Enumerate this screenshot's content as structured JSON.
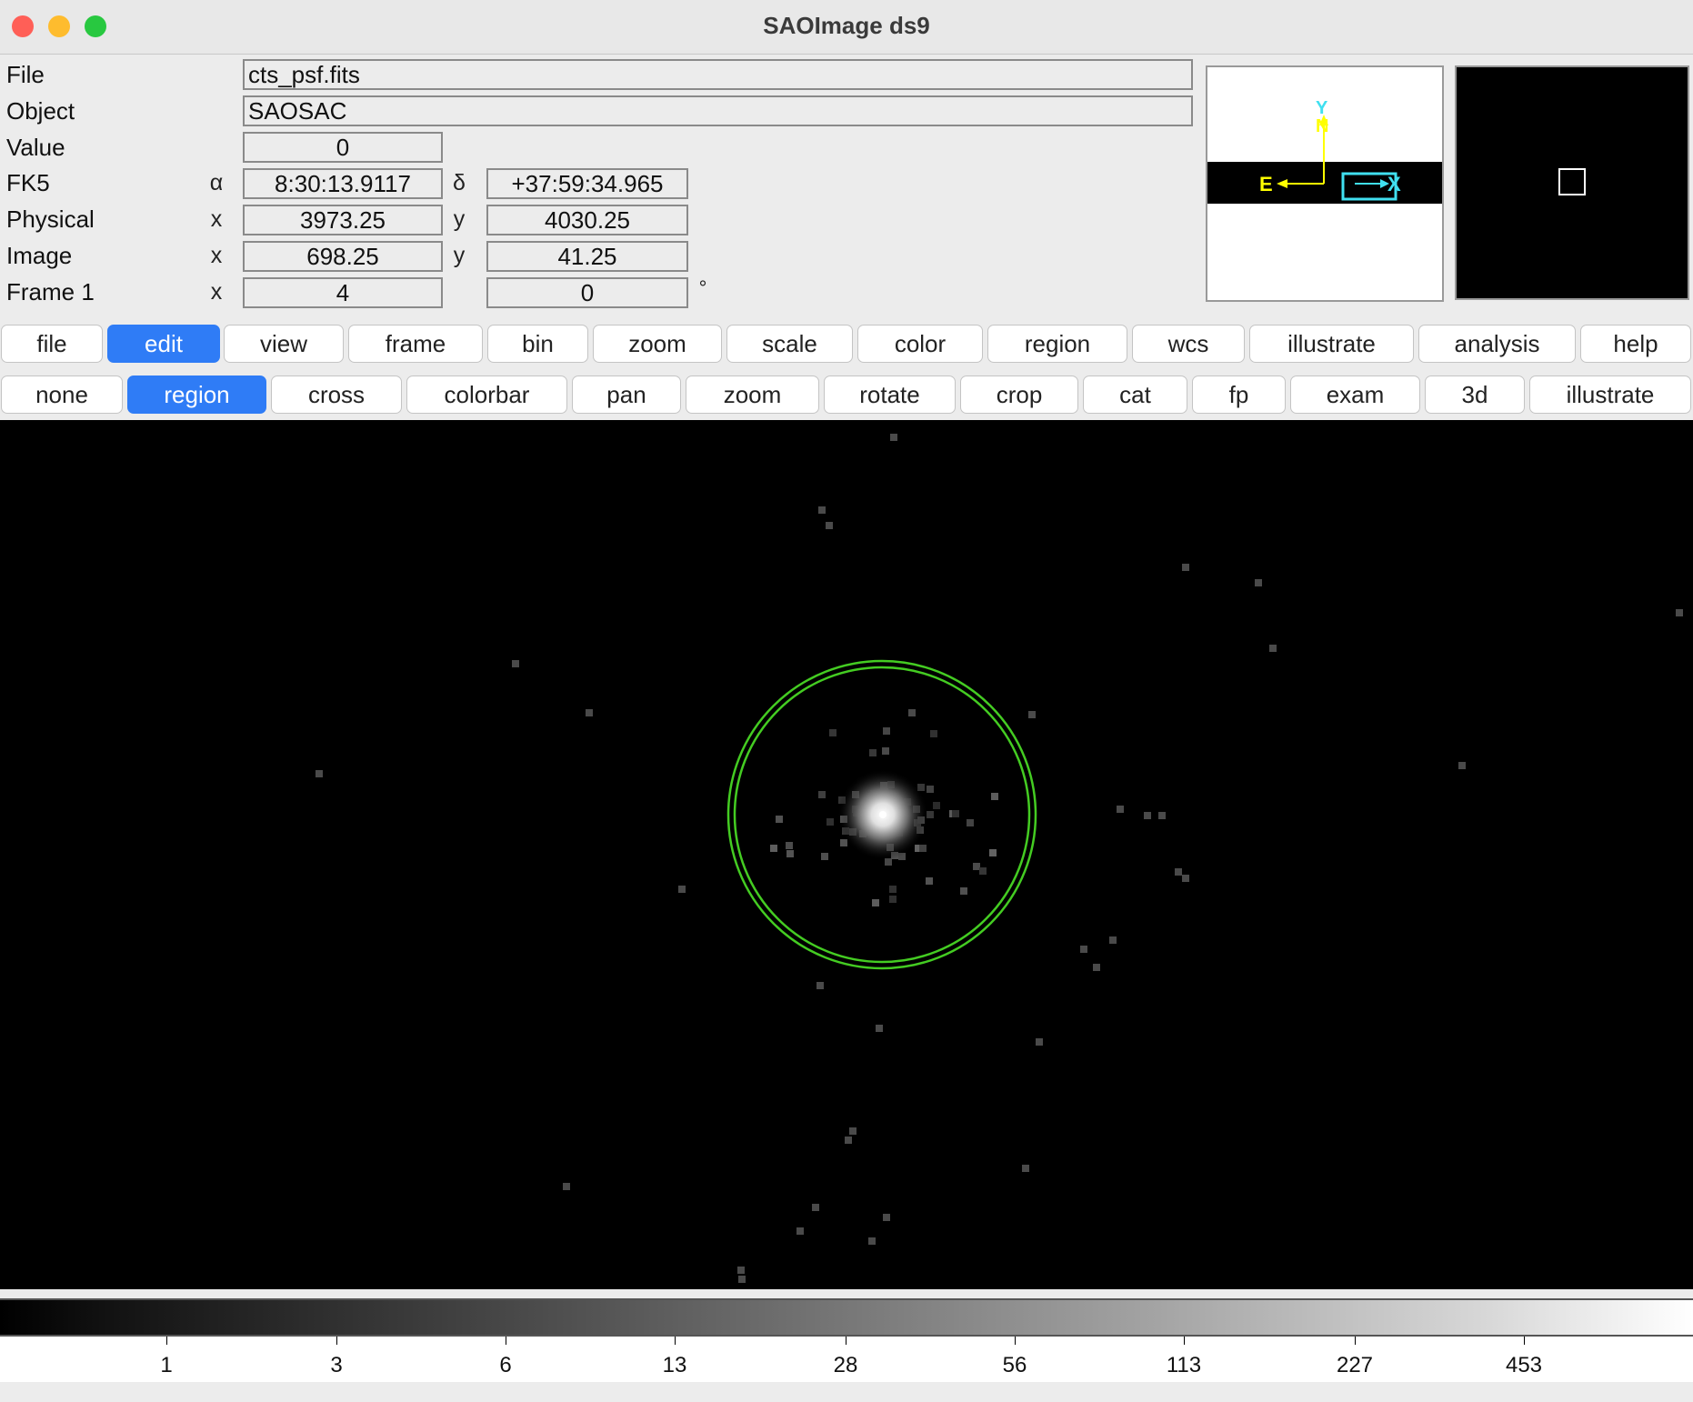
{
  "window": {
    "title": "SAOImage ds9",
    "traffic_lights": {
      "close": "#ff5f57",
      "minimize": "#febc2e",
      "zoom": "#28c840"
    }
  },
  "info_panel": {
    "file_label": "File",
    "file_value": "cts_psf.fits",
    "object_label": "Object",
    "object_value": "SAOSAC",
    "value_label": "Value",
    "value_value": "0",
    "fk5_label": "FK5",
    "fk5_alpha_symbol": "α",
    "fk5_alpha": "8:30:13.9117",
    "fk5_delta_symbol": "δ",
    "fk5_delta": "+37:59:34.965",
    "physical_label": "Physical",
    "physical_x_symbol": "x",
    "physical_x": "3973.25",
    "physical_y_symbol": "y",
    "physical_y": "4030.25",
    "image_label": "Image",
    "image_x_symbol": "x",
    "image_x": "698.25",
    "image_y_symbol": "y",
    "image_y": "41.25",
    "frame_label": "Frame 1",
    "frame_x_symbol": "x",
    "frame_zoom": "4",
    "frame_angle": "0",
    "frame_angle_unit": "°"
  },
  "magnifier": {
    "y_label": "Y",
    "n_label": "N",
    "e_label": "E",
    "x_label": "X",
    "compass_color": "#ffff00",
    "axis_color": "#40e0f0"
  },
  "main_menu": {
    "items": [
      "file",
      "edit",
      "view",
      "frame",
      "bin",
      "zoom",
      "scale",
      "color",
      "region",
      "wcs",
      "illustrate",
      "analysis",
      "help"
    ],
    "active": "edit"
  },
  "edit_menu": {
    "items": [
      "none",
      "region",
      "cross",
      "colorbar",
      "pan",
      "zoom",
      "rotate",
      "crop",
      "cat",
      "fp",
      "exam",
      "3d",
      "illustrate"
    ],
    "active": "region"
  },
  "image": {
    "region_shape": "circle",
    "region_color": "#44cc22"
  },
  "colorbar": {
    "labels": [
      "1",
      "3",
      "6",
      "13",
      "28",
      "56",
      "113",
      "227",
      "453"
    ]
  }
}
